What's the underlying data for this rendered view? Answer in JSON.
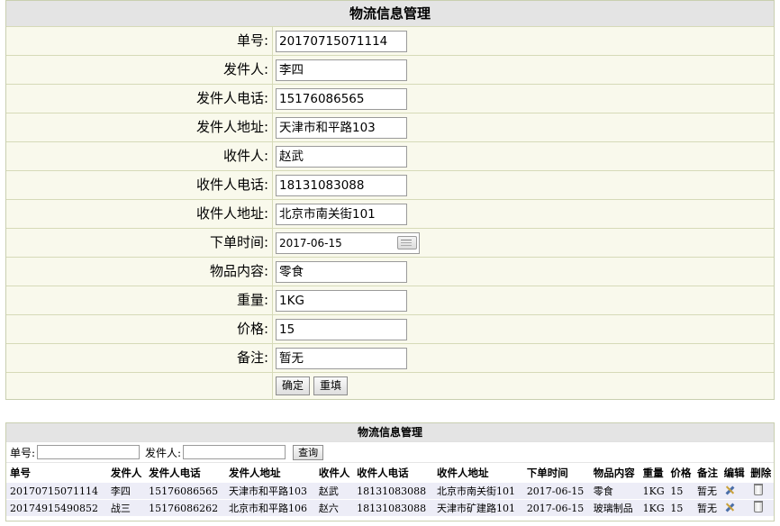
{
  "form": {
    "title": "物流信息管理",
    "fields": [
      {
        "label": "单号:",
        "value": "20170715071114"
      },
      {
        "label": "发件人:",
        "value": "李四"
      },
      {
        "label": "发件人电话:",
        "value": "15176086565"
      },
      {
        "label": "发件人地址:",
        "value": "天津市和平路103"
      },
      {
        "label": "收件人:",
        "value": "赵武"
      },
      {
        "label": "收件人电话:",
        "value": "18131083088"
      },
      {
        "label": "收件人地址:",
        "value": "北京市南关街101"
      },
      {
        "label": "下单时间:",
        "value": "2017-06-15"
      },
      {
        "label": "物品内容:",
        "value": "零食"
      },
      {
        "label": "重量:",
        "value": "1KG"
      },
      {
        "label": "价格:",
        "value": "15"
      },
      {
        "label": "备注:",
        "value": "暂无"
      }
    ],
    "confirm_label": "确定",
    "reset_label": "重填"
  },
  "list": {
    "title": "物流信息管理",
    "search": {
      "number_label": "单号:",
      "sender_label": "发件人:",
      "button_label": "查询"
    },
    "columns": [
      "单号",
      "发件人",
      "发件人电话",
      "发件人地址",
      "收件人",
      "收件人电话",
      "收件人地址",
      "下单时间",
      "物品内容",
      "重量",
      "价格",
      "备注",
      "编辑",
      "删除"
    ],
    "rows": [
      [
        "20170715071114",
        "李四",
        "15176086565",
        "天津市和平路103",
        "赵武",
        "18131083088",
        "北京市南关街101",
        "2017-06-15",
        "零食",
        "1KG",
        "15",
        "暂无"
      ],
      [
        "20174915490852",
        "战三",
        "15176086262",
        "北京市和平路106",
        "赵六",
        "18131083088",
        "天津市矿建路101",
        "2017-06-15",
        "玻璃制品",
        "1KG",
        "15",
        "暂无"
      ]
    ],
    "icons": {
      "edit": "edit-pencil-icon",
      "delete": "trash-can-icon"
    }
  }
}
